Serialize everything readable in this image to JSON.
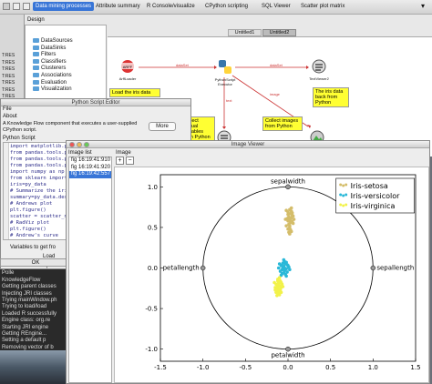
{
  "tabs": [
    {
      "label": "Data mining processes"
    },
    {
      "label": "Attribute summary"
    },
    {
      "label": "R Console/visualize"
    },
    {
      "label": "CPython scripting"
    },
    {
      "label": "SQL Viewer"
    },
    {
      "label": "Scatter plot matrix"
    }
  ],
  "design": {
    "label": "Design",
    "items": [
      {
        "label": "DataSources"
      },
      {
        "label": "DataSinks"
      },
      {
        "label": "Filters"
      },
      {
        "label": "Classifiers"
      },
      {
        "label": "Clusterers"
      },
      {
        "label": "Associations"
      },
      {
        "label": "Evaluation"
      },
      {
        "label": "Visualization"
      }
    ]
  },
  "left_strip": [
    "T:RES",
    "T:RES",
    "T:RES",
    "T:RES",
    "T:RES",
    "T:RES",
    "T:RES",
    "T:RES",
    "T:RES",
    "T:RES"
  ],
  "flow_tabs": [
    {
      "label": "Untitled1"
    },
    {
      "label": "Untitled2"
    }
  ],
  "nodes": [
    {
      "label": "ArffLoader"
    },
    {
      "label": "PythonScript\nExecutor"
    },
    {
      "label": "TextViewer2"
    },
    {
      "label": "TextViewer"
    },
    {
      "label": "ImageViewer"
    }
  ],
  "edges": [
    {
      "label": "dataSet"
    },
    {
      "label": "dataSet"
    },
    {
      "label": "text"
    },
    {
      "label": "image"
    }
  ],
  "notes": {
    "load_iris": "Load the iris data",
    "iris_back": "The iris data back from Python",
    "collect_text": "Collect textual variables from Python",
    "collect_images": "Collect images from Python"
  },
  "script_editor": {
    "title": "Python Script Editor",
    "file_menu": "File",
    "about_label": "About",
    "about_text": "A Knowledge Flow component that executes a user-supplied CPython script.",
    "more_button": "More",
    "python_script_label": "Python Script",
    "code": [
      "import matplotlib.pyp",
      "from pandas.tools.plo",
      "from pandas.tools.plo",
      "from pandas.tools.plo",
      "import numpy as np",
      "from sklearn import ",
      "iris=py_data",
      "# Summarize the iris",
      "summary=py_data.desc",
      "# Andrews plot",
      "plt.figure()",
      "scatter = scatter_ma",
      "# RadViz plot",
      "plt.figure()",
      "# Andrew's curve"
    ],
    "vars_text": "Variables to get fro",
    "load_btn": "Load",
    "output_label": "Output debu",
    "ok": "OK"
  },
  "log": {
    "lines": [
      "Loaded",
      "Polle",
      "KnowledgeFlow",
      "Getting parent classes",
      "Injecting JRI classes",
      "Trying mainWindow.ph",
      "Trying to load/load",
      "Loaded R successfully",
      "Engine class: org.re",
      "Starting JRI engine",
      "Getting REngine...",
      "Setting a default p",
      "Removing vector of b"
    ]
  },
  "image_viewer": {
    "title": "Image Viewer",
    "image_list_label": "Image list",
    "image_label": "Image",
    "images": [
      {
        "label": "fig 16:19:41:910"
      },
      {
        "label": "fig 16:19:41:920"
      },
      {
        "label": "fig 16:19:42:557"
      }
    ]
  },
  "chart_data": {
    "type": "scatter",
    "title": "",
    "xlabel": "",
    "ylabel": "",
    "xlim": [
      -1.5,
      1.5
    ],
    "ylim": [
      -1.15,
      1.15
    ],
    "xticks": [
      "-1.5",
      "-1.0",
      "-0.5",
      "0.0",
      "0.5",
      "1.0",
      "1.5"
    ],
    "yticks": [
      "1.0",
      "0.5",
      "0.0",
      "-0.5",
      "-1.0"
    ],
    "anchors": [
      {
        "name": "sepalwidth",
        "x": 0,
        "y": 1
      },
      {
        "name": "sepallength",
        "x": 1,
        "y": 0
      },
      {
        "name": "petalwidth",
        "x": 0,
        "y": -1
      },
      {
        "name": "petallength",
        "x": -1,
        "y": 0
      }
    ],
    "legend_position": "top-right",
    "series": [
      {
        "name": "Iris-setosa",
        "color": "#d4bd6a",
        "points": [
          [
            0.02,
            0.72
          ],
          [
            0.04,
            0.74
          ],
          [
            -0.02,
            0.71
          ],
          [
            0.0,
            0.69
          ],
          [
            0.03,
            0.67
          ],
          [
            0.05,
            0.65
          ],
          [
            0.01,
            0.63
          ],
          [
            -0.01,
            0.61
          ],
          [
            0.02,
            0.6
          ],
          [
            0.04,
            0.62
          ],
          [
            0.06,
            0.64
          ],
          [
            0.0,
            0.58
          ],
          [
            0.03,
            0.56
          ],
          [
            0.01,
            0.54
          ],
          [
            0.05,
            0.57
          ],
          [
            -0.03,
            0.6
          ],
          [
            0.02,
            0.52
          ],
          [
            0.07,
            0.6
          ],
          [
            0.04,
            0.7
          ],
          [
            0.0,
            0.66
          ],
          [
            0.02,
            0.5
          ],
          [
            0.06,
            0.55
          ],
          [
            0.03,
            0.47
          ],
          [
            0.01,
            0.44
          ],
          [
            0.02,
            0.42
          ],
          [
            0.04,
            0.45
          ],
          [
            0.0,
            0.48
          ],
          [
            -0.02,
            0.52
          ],
          [
            0.03,
            0.59
          ],
          [
            0.05,
            0.68
          ]
        ]
      },
      {
        "name": "Iris-versicolor",
        "color": "#29b8d8",
        "points": [
          [
            -0.05,
            0.02
          ],
          [
            -0.02,
            -0.01
          ],
          [
            0.0,
            0.03
          ],
          [
            -0.04,
            -0.03
          ],
          [
            -0.06,
            0.0
          ],
          [
            -0.03,
            0.05
          ],
          [
            -0.01,
            -0.05
          ],
          [
            -0.07,
            -0.02
          ],
          [
            -0.08,
            0.03
          ],
          [
            -0.02,
            0.07
          ],
          [
            0.01,
            0.01
          ],
          [
            -0.04,
            0.08
          ],
          [
            -0.09,
            -0.04
          ],
          [
            -0.05,
            -0.06
          ],
          [
            -0.03,
            -0.08
          ],
          [
            -0.1,
            0.05
          ],
          [
            0.02,
            -0.02
          ],
          [
            -0.06,
            0.06
          ],
          [
            -0.07,
            -0.07
          ],
          [
            -0.04,
            0.0
          ],
          [
            -0.02,
            -0.1
          ],
          [
            -0.08,
            -0.09
          ],
          [
            -0.01,
            0.04
          ],
          [
            -0.05,
            0.1
          ],
          [
            -0.11,
            0.0
          ]
        ]
      },
      {
        "name": "Iris-virginica",
        "color": "#f2f24a",
        "points": [
          [
            -0.1,
            -0.12
          ],
          [
            -0.12,
            -0.16
          ],
          [
            -0.08,
            -0.18
          ],
          [
            -0.14,
            -0.2
          ],
          [
            -0.1,
            -0.22
          ],
          [
            -0.12,
            -0.25
          ],
          [
            -0.09,
            -0.27
          ],
          [
            -0.13,
            -0.29
          ],
          [
            -0.11,
            -0.31
          ],
          [
            -0.08,
            -0.24
          ],
          [
            -0.15,
            -0.24
          ],
          [
            -0.07,
            -0.2
          ],
          [
            -0.1,
            -0.33
          ],
          [
            -0.12,
            -0.14
          ],
          [
            -0.16,
            -0.18
          ],
          [
            -0.09,
            -0.16
          ],
          [
            -0.14,
            -0.3
          ],
          [
            -0.11,
            -0.19
          ],
          [
            -0.06,
            -0.23
          ],
          [
            -0.13,
            -0.34
          ],
          [
            -0.1,
            -0.28
          ],
          [
            -0.12,
            -0.22
          ],
          [
            -0.15,
            -0.27
          ],
          [
            -0.08,
            -0.3
          ],
          [
            -0.11,
            -0.26
          ]
        ]
      }
    ]
  }
}
